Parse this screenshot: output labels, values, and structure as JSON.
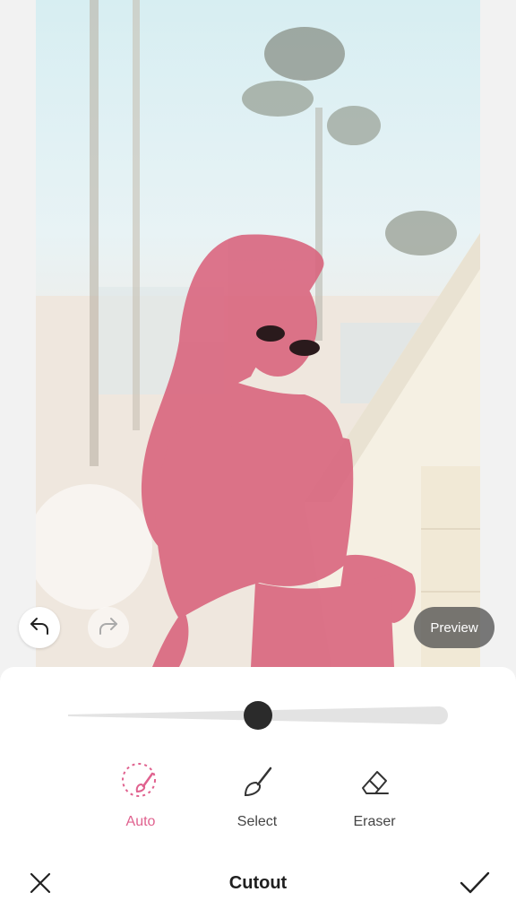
{
  "screen": {
    "title": "Cutout",
    "accent_color": "#e0628f"
  },
  "photo": {
    "subject": "woman-with-pink-selection-mask",
    "mask_color": "#d9627c"
  },
  "controls": {
    "undo_icon": "undo-arrow-icon",
    "redo_icon": "redo-arrow-icon",
    "preview_label": "Preview"
  },
  "slider": {
    "value": 0.5
  },
  "tools": [
    {
      "label": "Auto",
      "icon": "auto-brush-icon",
      "active": true
    },
    {
      "label": "Select",
      "icon": "brush-icon",
      "active": false
    },
    {
      "label": "Eraser",
      "icon": "eraser-icon",
      "active": false
    }
  ],
  "bottom_bar": {
    "close_icon": "close-icon",
    "confirm_icon": "check-icon"
  }
}
